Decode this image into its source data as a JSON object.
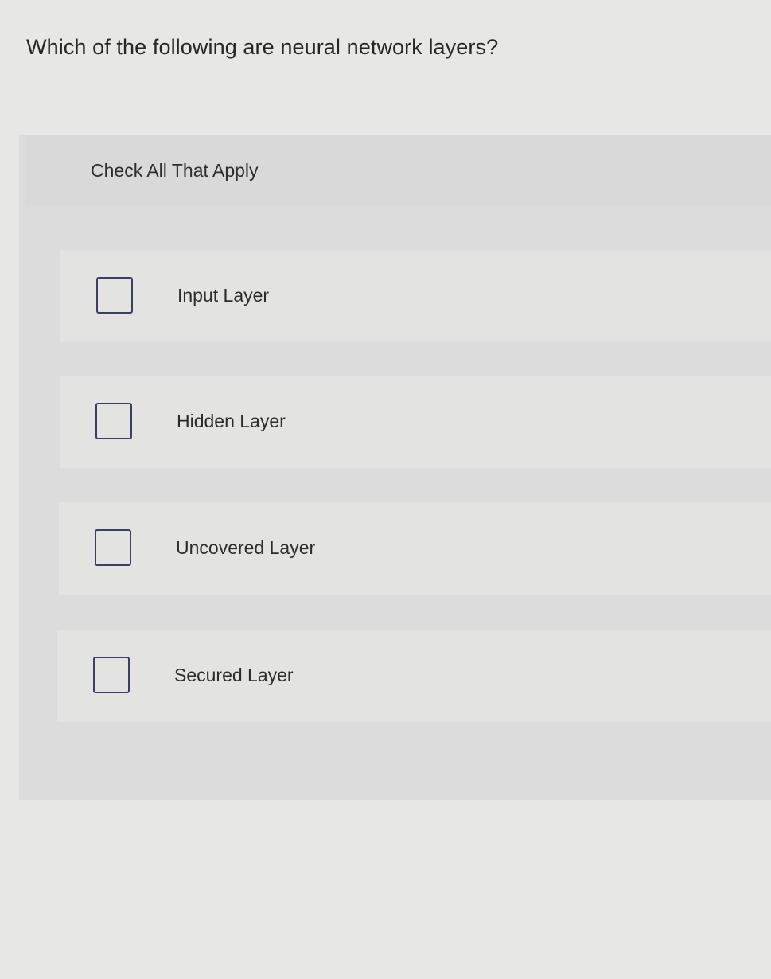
{
  "question": {
    "text": "Which of the following are neural network layers?"
  },
  "panel": {
    "instructions": "Check All That Apply",
    "options": [
      {
        "label": "Input Layer",
        "checked": false
      },
      {
        "label": "Hidden Layer",
        "checked": false
      },
      {
        "label": "Uncovered Layer",
        "checked": false
      },
      {
        "label": "Secured Layer",
        "checked": false
      }
    ]
  },
  "colors": {
    "background": "#e7e7e6",
    "panel": "#dcdcdc",
    "option_background": "#e3e3e2",
    "checkbox_border": "#3b3f63",
    "text": "#2c2c2c"
  }
}
